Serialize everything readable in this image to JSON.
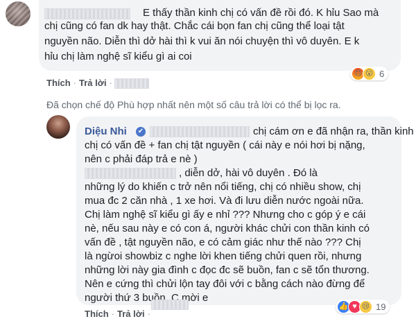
{
  "comment_top": {
    "text_lines": [
      "E thấy thần kinh chị có vấn đề rồi đó. K hỉu Sao mà",
      "chị cũng có fan dk hay thật. Chắc cái bọn fan chị cũng thể loại tật",
      "nguyền não. Diễn thì dở hài thì k vui ăn nói chuyện thì vô duyên. E k",
      "hỉu chị làm nghệ sĩ kiểu gì ai coi"
    ],
    "reaction_icons": [
      "angry-icon",
      "wow-icon"
    ],
    "reaction_count": "6",
    "like_label": "Thích",
    "reply_label": "Trả lời",
    "separator": "·"
  },
  "filter_notice": "Đã chọn chế độ Phù hợp nhất nên một số câu trả lời có thể bị lọc ra.",
  "reply": {
    "author": "Diệu Nhi",
    "text_lines": [
      "chị cám ơn e đã nhận ra, thần kinh",
      "chị có vấn đề + fan chị tật nguyền ( cái này e nói hơi bị nặng,",
      "nên c phải đáp trả e nè )",
      ", diễn dở, hài vô duyên . Đó là",
      "những lý do khiến c trở nên nổi tiếng, chị có nhiều show, chị",
      "mua đc 2 căn nhà , 1 xe hơi. Và đi lưu diễn nước ngoài nữa.",
      "Chị làm nghệ sĩ kiểu gì ấy e nhỉ ??? Nhưng cho c góp ý e cái",
      "nè, nếu sau này e có con á, người khác chửi con thần kinh có",
      "vấn đề , tật nguyền não, e có cảm giác như thế nào ??? Chị",
      "là ngừoi showbiz c nghe lời khen tiếng chửi quen rồi, nhưng",
      "những lời này gia đình c đọc đc sẽ buồn, fan c sẽ tổn thương.",
      "Nên e cứng thì chửi lộn tay đôi với c bằng cách nào đừng để",
      "người thứ 3 buồn. C mời e"
    ],
    "reaction_icons": [
      "like-icon",
      "love-icon",
      "sad-icon"
    ],
    "reaction_count": "19",
    "like_label": "Thích",
    "reply_label": "Trả lời",
    "separator": "·"
  },
  "icons": {
    "verified": "✔",
    "angry": "😠",
    "wow": "😮",
    "like": "👍",
    "love": "♥",
    "sad": "😢"
  }
}
